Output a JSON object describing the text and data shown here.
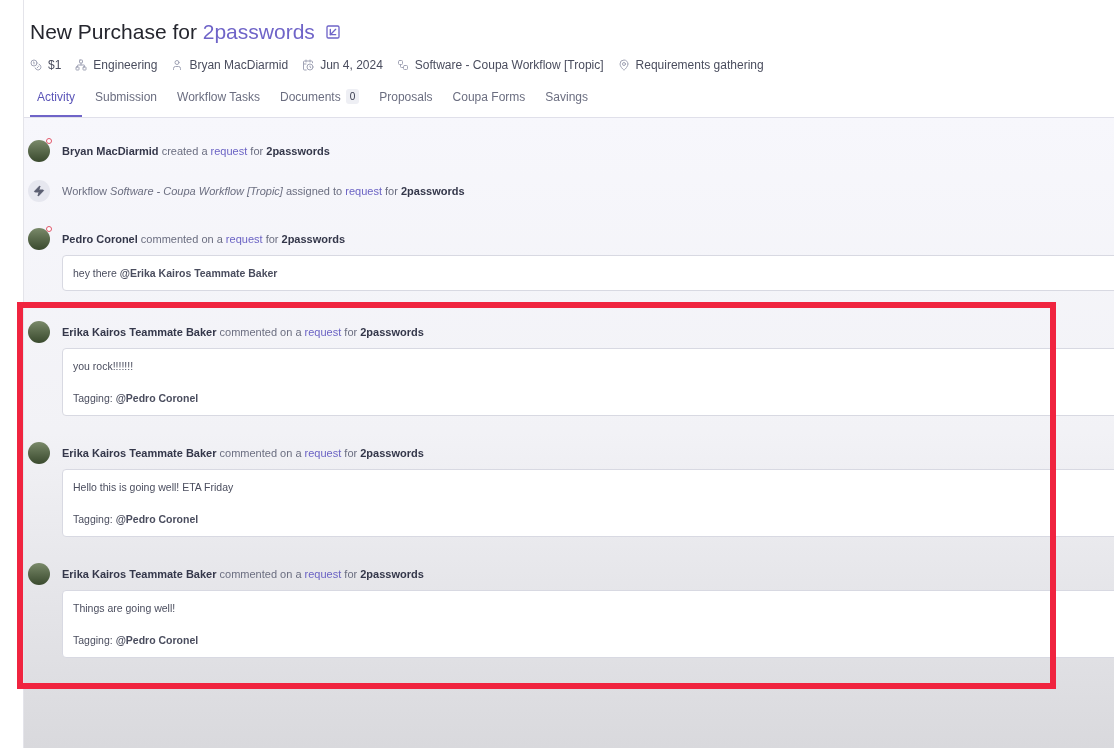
{
  "header": {
    "title": "New Purchase for",
    "title_link": "2passwords",
    "meta": [
      {
        "kind": "coins",
        "text": "$1"
      },
      {
        "kind": "org",
        "text": "Engineering"
      },
      {
        "kind": "person",
        "text": "Bryan MacDiarmid"
      },
      {
        "kind": "date",
        "text": "Jun 4, 2024"
      },
      {
        "kind": "workflow",
        "text": "Software - Coupa Workflow [Tropic]"
      },
      {
        "kind": "pin",
        "text": "Requirements gathering"
      }
    ]
  },
  "tabs": [
    {
      "label": "Activity",
      "selected": true
    },
    {
      "label": "Submission",
      "selected": false
    },
    {
      "label": "Workflow Tasks",
      "selected": false
    },
    {
      "label": "Documents",
      "selected": false,
      "badge": "0"
    },
    {
      "label": "Proposals",
      "selected": false
    },
    {
      "label": "Coupa Forms",
      "selected": false
    },
    {
      "label": "Savings",
      "selected": false
    }
  ],
  "activity": [
    {
      "kind": "photo",
      "notification": true,
      "actor": "Bryan MacDiarmid",
      "action": "created a",
      "link": "request",
      "tail": "for",
      "subject": "2passwords"
    },
    {
      "kind": "bolt",
      "notification": false,
      "action": "Workflow *Software - Coupa Workflow [Tropic]* assigned to",
      "link": "request",
      "tail": "for",
      "subject": "2passwords"
    },
    {
      "kind": "photo",
      "notification": true,
      "actor": "Pedro Coronel",
      "action": "commented on a",
      "link": "request",
      "tail": "for",
      "subject": "2passwords",
      "comment": [
        "hey there **@Erika Kairos Teammate Baker**"
      ]
    },
    {
      "kind": "photo",
      "notification": false,
      "highlighted": true,
      "actor": "Erika Kairos Teammate Baker",
      "action": "commented on a",
      "link": "request",
      "tail": "for",
      "subject": "2passwords",
      "comment": [
        "you rock!!!!!!!",
        "Tagging: **@Pedro Coronel**"
      ]
    },
    {
      "kind": "photo",
      "notification": false,
      "highlighted": true,
      "actor": "Erika Kairos Teammate Baker",
      "action": "commented on a",
      "link": "request",
      "tail": "for",
      "subject": "2passwords",
      "comment": [
        "Hello this is going well! ETA Friday",
        "Tagging: **@Pedro Coronel**"
      ]
    },
    {
      "kind": "photo",
      "notification": false,
      "highlighted": true,
      "actor": "Erika Kairos Teammate Baker",
      "action": "commented on a",
      "link": "request",
      "tail": "for",
      "subject": "2passwords",
      "comment": [
        "Things are going well!",
        "Tagging: **@Pedro Coronel**"
      ]
    }
  ]
}
